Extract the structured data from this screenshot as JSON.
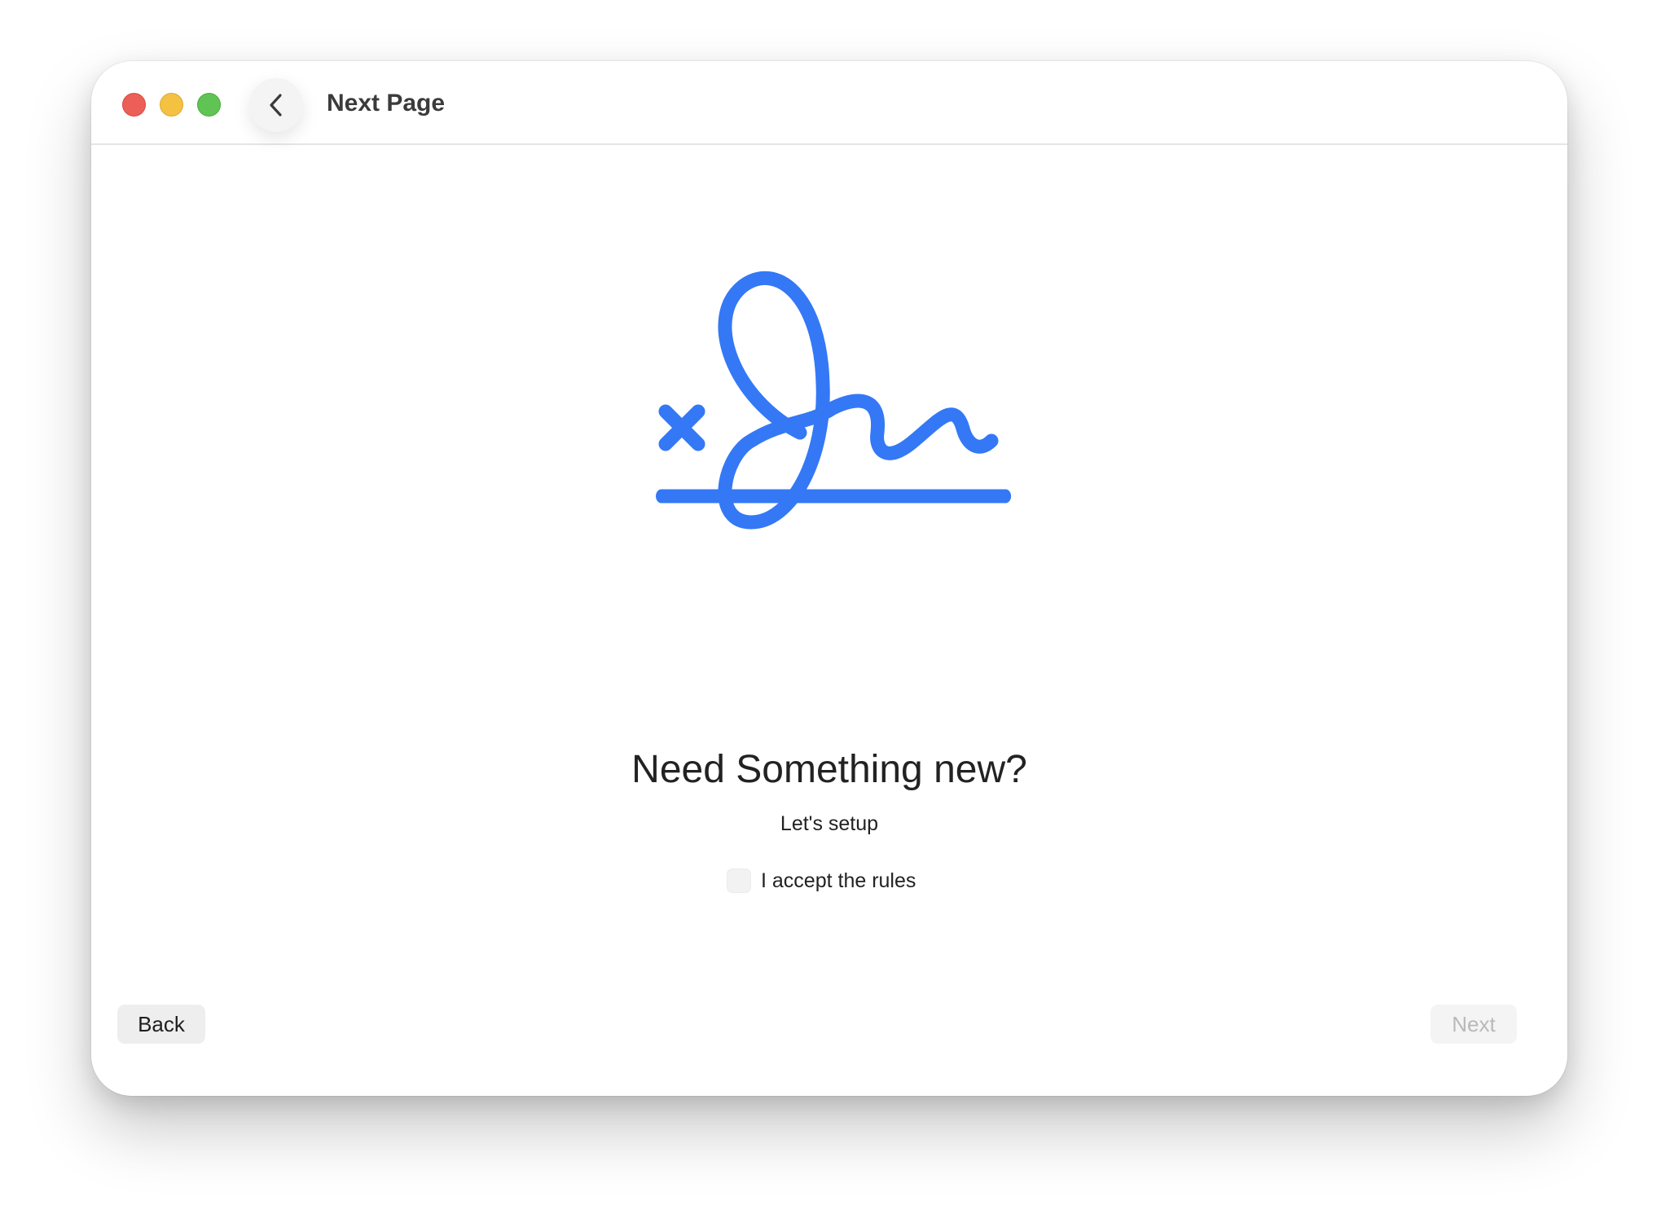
{
  "window": {
    "title": "Next Page",
    "traffic_lights": {
      "close_color": "#ec5f57",
      "minimize_color": "#f4c143",
      "zoom_color": "#5fc454"
    },
    "nav_back_icon": "chevron-left-icon"
  },
  "illustration": {
    "icon": "signature-icon",
    "color": "#3478f6"
  },
  "content": {
    "heading": "Need Something new?",
    "subheading": "Let's setup",
    "accept_label": "I accept the rules",
    "accept_checked": false
  },
  "footer": {
    "back_label": "Back",
    "next_label": "Next",
    "next_enabled": false
  }
}
